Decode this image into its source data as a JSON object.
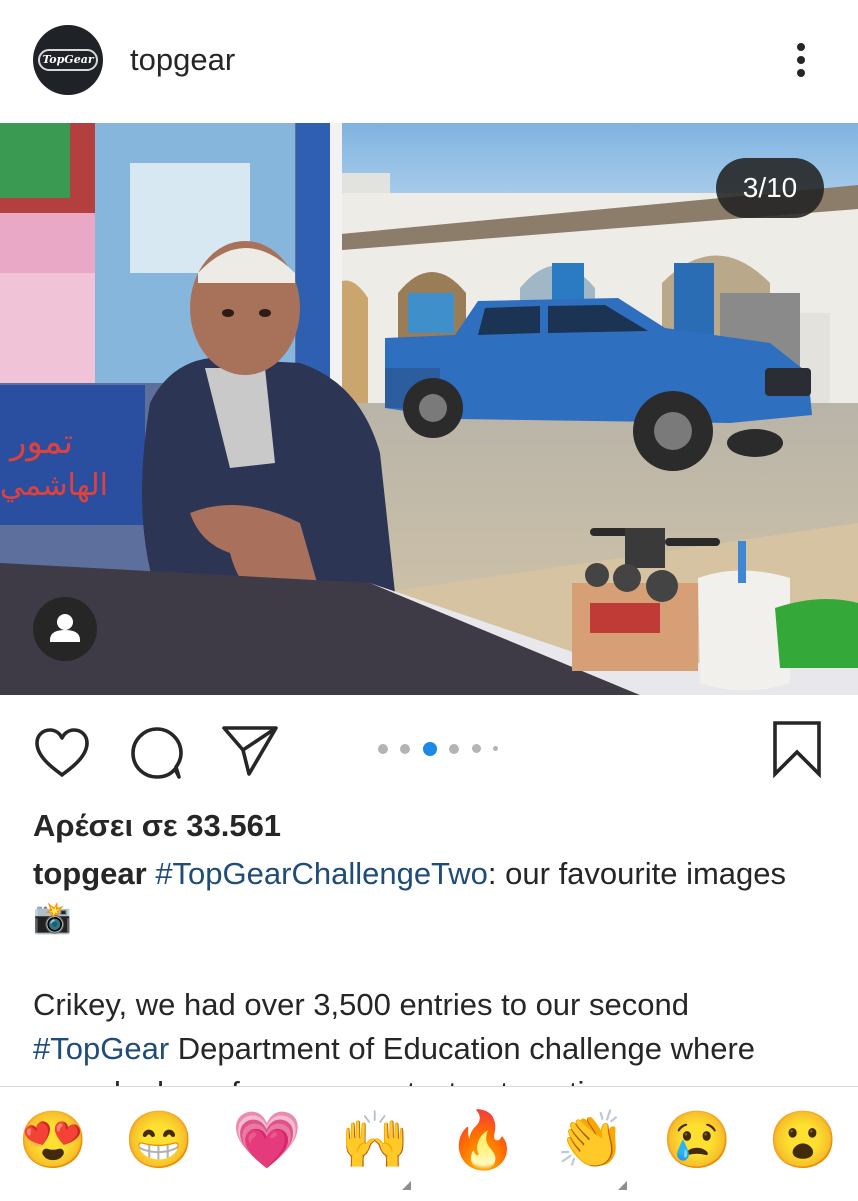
{
  "post": {
    "username": "topgear",
    "avatar_logo_text": "TopGear",
    "image_counter": "3/10",
    "likes_text": "Αρέσει σε 33.561",
    "caption": {
      "author": "topgear",
      "hashtag": "#TopGearChallengeTwo",
      "text": ": our favourite images",
      "emoji": "📸"
    },
    "body": {
      "line1": "Crikey, we had over 3,500 entries to our second",
      "hashtag": "#TopGear",
      "line2_rest": " Department of Education challenge where",
      "line3_partial": "we asked you for your greatest automotive snaps"
    },
    "carousel": {
      "total_dots": 6,
      "active_index": 2
    }
  },
  "photo_text": {
    "sign_line1": "تمور",
    "sign_line2": "الهاشمي"
  },
  "icons": {
    "more": "more-vertical-icon",
    "like": "heart-outline-icon",
    "comment": "comment-bubble-icon",
    "share": "paper-plane-icon",
    "save": "bookmark-icon",
    "tag": "person-tag-icon"
  },
  "emoji_bar": [
    {
      "name": "heart-eyes-emoji",
      "glyph": "😍"
    },
    {
      "name": "grinning-emoji",
      "glyph": "😁"
    },
    {
      "name": "pink-heart-emoji",
      "glyph": "💗"
    },
    {
      "name": "raised-hands-emoji",
      "glyph": "🙌"
    },
    {
      "name": "fire-emoji",
      "glyph": "🔥"
    },
    {
      "name": "clapping-hands-emoji",
      "glyph": "👏"
    },
    {
      "name": "crying-face-emoji",
      "glyph": "😢"
    },
    {
      "name": "surprised-face-emoji",
      "glyph": "😮"
    }
  ],
  "colors": {
    "text": "#262626",
    "hashtag": "#1f4c7a",
    "dot_active": "#1a8ae6",
    "dot_inactive": "#b4b4b4",
    "truck": "#2f6fc0"
  }
}
